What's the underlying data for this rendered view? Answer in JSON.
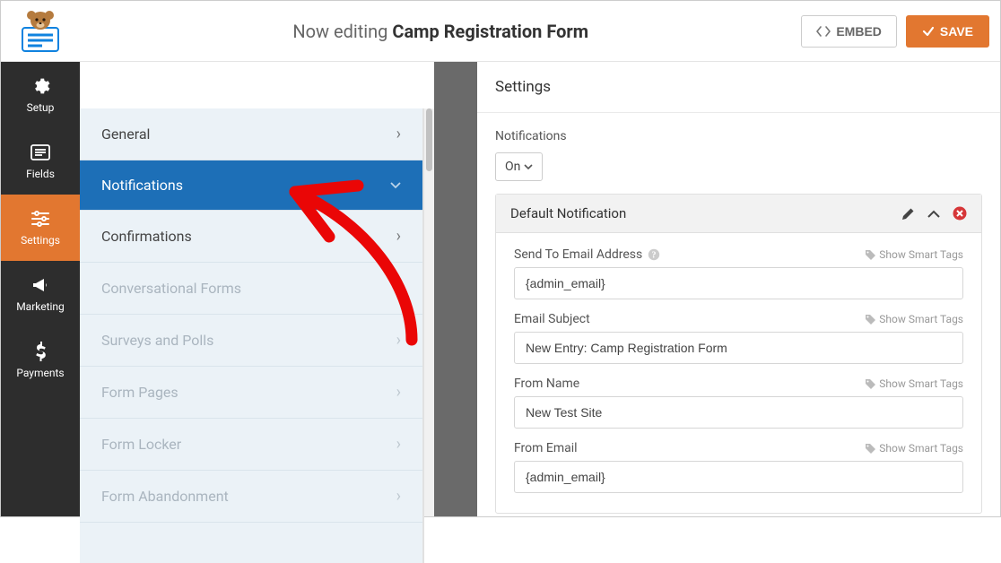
{
  "topbar": {
    "editing_prefix": "Now editing ",
    "form_title": "Camp Registration Form",
    "embed_label": "EMBED",
    "save_label": "SAVE"
  },
  "rail": {
    "items": [
      {
        "id": "setup",
        "label": "Setup",
        "icon": "gear"
      },
      {
        "id": "fields",
        "label": "Fields",
        "icon": "list"
      },
      {
        "id": "settings",
        "label": "Settings",
        "icon": "sliders",
        "active": true
      },
      {
        "id": "marketing",
        "label": "Marketing",
        "icon": "bullhorn"
      },
      {
        "id": "payments",
        "label": "Payments",
        "icon": "dollar"
      }
    ]
  },
  "subpanel": {
    "items": [
      {
        "id": "general",
        "label": "General",
        "state": "normal"
      },
      {
        "id": "notifications",
        "label": "Notifications",
        "state": "active"
      },
      {
        "id": "confirmations",
        "label": "Confirmations",
        "state": "normal"
      },
      {
        "id": "conversational-forms",
        "label": "Conversational Forms",
        "state": "dim"
      },
      {
        "id": "surveys-and-polls",
        "label": "Surveys and Polls",
        "state": "dim"
      },
      {
        "id": "form-pages",
        "label": "Form Pages",
        "state": "dim"
      },
      {
        "id": "form-locker",
        "label": "Form Locker",
        "state": "dim"
      },
      {
        "id": "form-abandonment",
        "label": "Form Abandonment",
        "state": "dim"
      }
    ]
  },
  "content": {
    "heading": "Settings",
    "notifications_label": "Notifications",
    "notifications_toggle": "On",
    "card": {
      "title": "Default Notification",
      "smart_tags_label": "Show Smart Tags",
      "fields": [
        {
          "label": "Send To Email Address",
          "value": "{admin_email}",
          "help": true
        },
        {
          "label": "Email Subject",
          "value": "New Entry: Camp Registration Form",
          "help": false
        },
        {
          "label": "From Name",
          "value": "New Test Site",
          "help": false
        },
        {
          "label": "From Email",
          "value": "{admin_email}",
          "help": false
        }
      ]
    }
  },
  "colors": {
    "accent_orange": "#e27730",
    "active_blue": "#1d6fb7",
    "rail_bg": "#2d2d2d",
    "subpanel_bg": "#ebf2f7",
    "annotation_red": "#ea0606"
  }
}
